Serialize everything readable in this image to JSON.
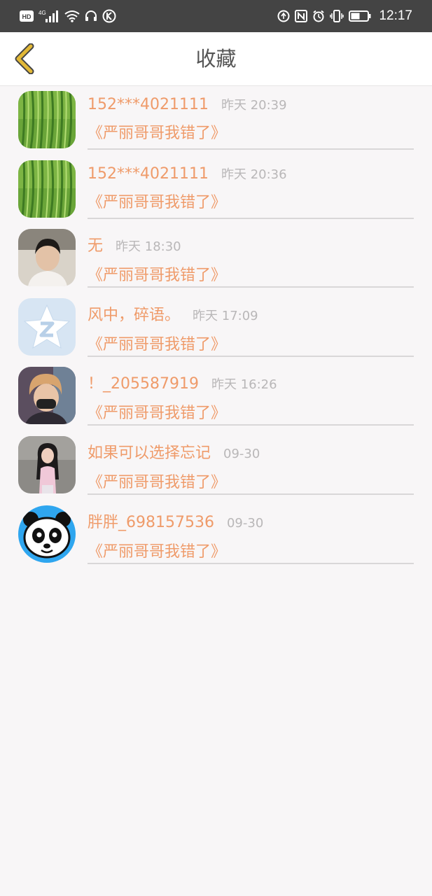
{
  "status_bar": {
    "left_icons": [
      "hd-icon",
      "signal-4g-icon",
      "wifi-icon",
      "headset-icon",
      "k-app-icon"
    ],
    "right_icons": [
      "nfc-icon",
      "alarm-icon",
      "vibrate-icon",
      "battery-icon"
    ],
    "time": "12:17",
    "hd_label": "HD",
    "net_label": "4G"
  },
  "header": {
    "title": "收藏",
    "back_icon": "chevron-left-icon",
    "accent": "#e2b836"
  },
  "colors": {
    "name": "#ef9b6a",
    "time": "#b9b7b8",
    "background": "#f8f6f7"
  },
  "favorites": [
    {
      "name": "152***4021111",
      "time": "昨天 20:39",
      "quote": "《严丽哥哥我错了》",
      "avatar": "willow-avatar"
    },
    {
      "name": "152***4021111",
      "time": "昨天 20:36",
      "quote": "《严丽哥哥我错了》",
      "avatar": "willow-avatar"
    },
    {
      "name": "无",
      "time": "昨天 18:30",
      "quote": "《严丽哥哥我错了》",
      "avatar": "photo-avatar"
    },
    {
      "name": "风中，碎语。",
      "time": "昨天 17:09",
      "quote": "《严丽哥哥我错了》",
      "avatar": "star-avatar"
    },
    {
      "name": "！_205587919",
      "time": "昨天 16:26",
      "quote": "《严丽哥哥我错了》",
      "avatar": "photo-avatar"
    },
    {
      "name": "如果可以选择忘记",
      "time": "09-30",
      "quote": "《严丽哥哥我错了》",
      "avatar": "photo-avatar"
    },
    {
      "name": "胖胖_698157536",
      "time": "09-30",
      "quote": "《严丽哥哥我错了》",
      "avatar": "panda-avatar"
    }
  ]
}
